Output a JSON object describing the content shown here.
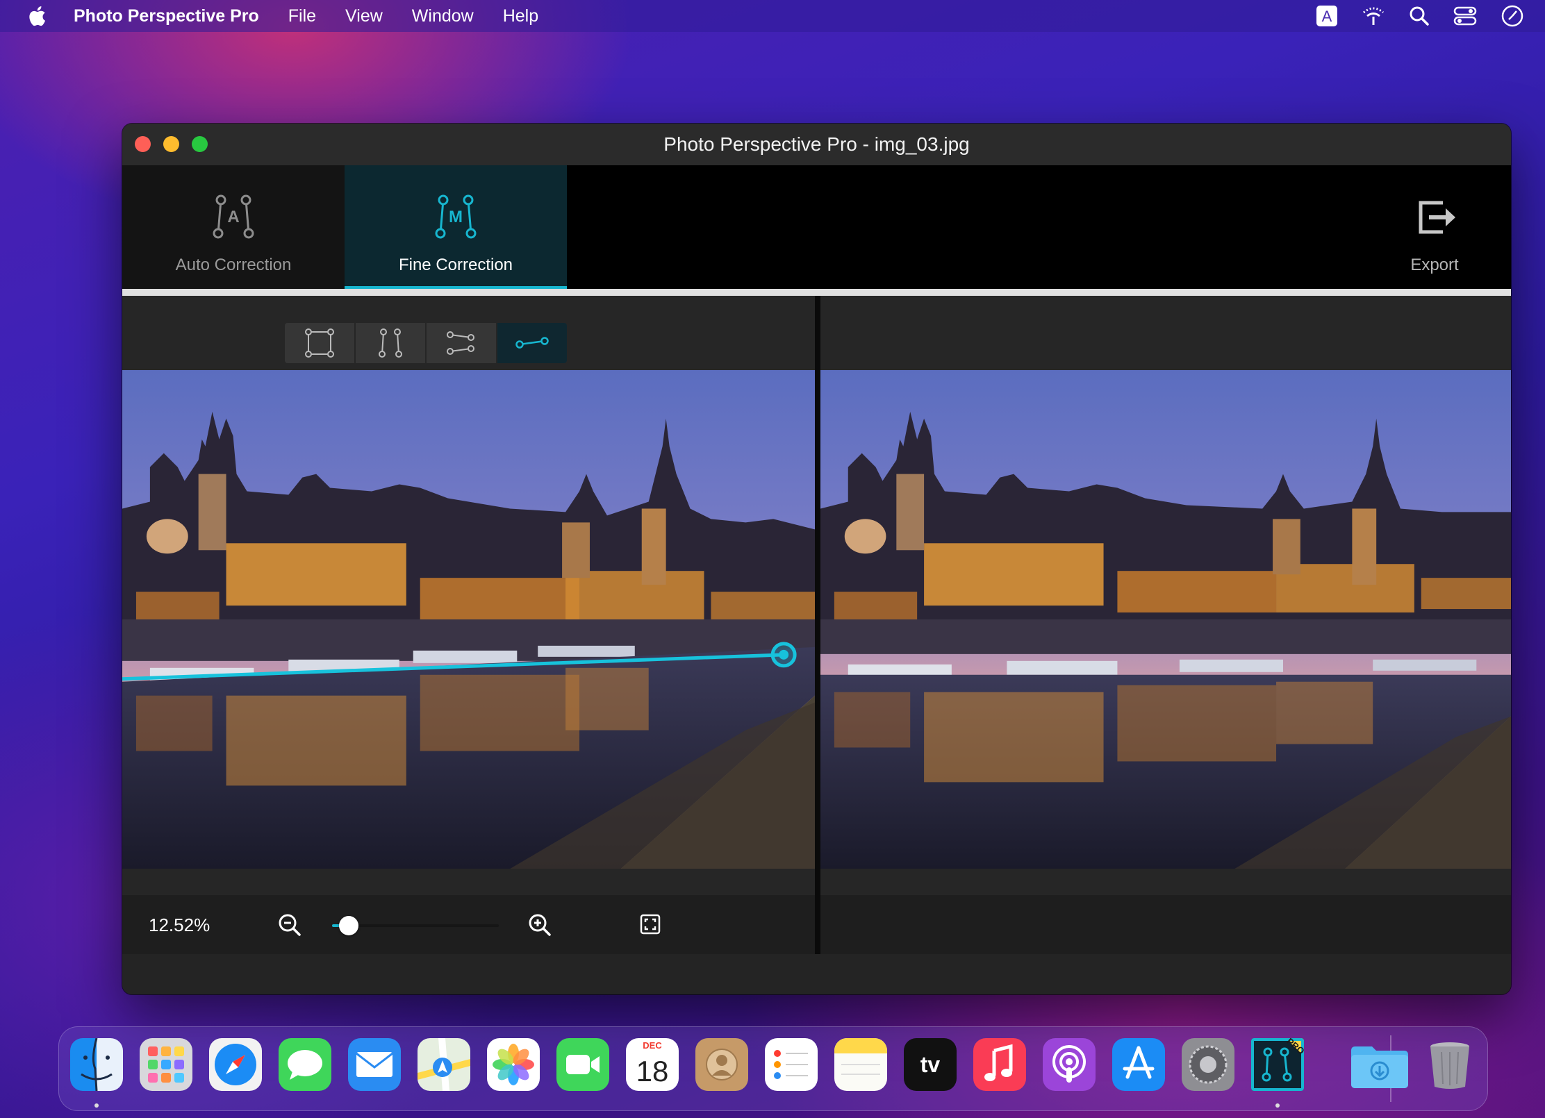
{
  "menubar": {
    "app_name": "Photo Perspective Pro",
    "menus": [
      "File",
      "View",
      "Window",
      "Help"
    ],
    "keyboard_indicator": "A"
  },
  "window": {
    "title": "Photo Perspective Pro - img_03.jpg"
  },
  "toolbar": {
    "tabs": [
      {
        "label": "Auto Correction",
        "icon_letter": "A",
        "selected": false
      },
      {
        "label": "Fine Correction",
        "icon_letter": "M",
        "selected": true
      }
    ],
    "export_label": "Export"
  },
  "modes": [
    {
      "name": "rectangle-mode",
      "selected": false
    },
    {
      "name": "vertical-lines-mode",
      "selected": false
    },
    {
      "name": "horizontal-lines-mode",
      "selected": false
    },
    {
      "name": "single-line-mode",
      "selected": true
    }
  ],
  "zoom": {
    "value_label": "12.52%",
    "slider_fraction": 0.1
  },
  "dock": {
    "calendar_month": "DEC",
    "calendar_day": "18",
    "tv_label": "tv",
    "pro_badge": "PRO",
    "apps": [
      "Finder",
      "Launchpad",
      "Safari",
      "Messages",
      "Mail",
      "Maps",
      "Photos",
      "FaceTime",
      "Calendar",
      "Contacts",
      "Reminders",
      "Notes",
      "Apple TV",
      "Music",
      "Podcasts",
      "App Store",
      "System Preferences",
      "Photo Perspective Pro",
      "Downloads",
      "Trash"
    ]
  },
  "colors": {
    "accent": "#17b6cf",
    "selected_tab_bg": "#0c2830"
  }
}
